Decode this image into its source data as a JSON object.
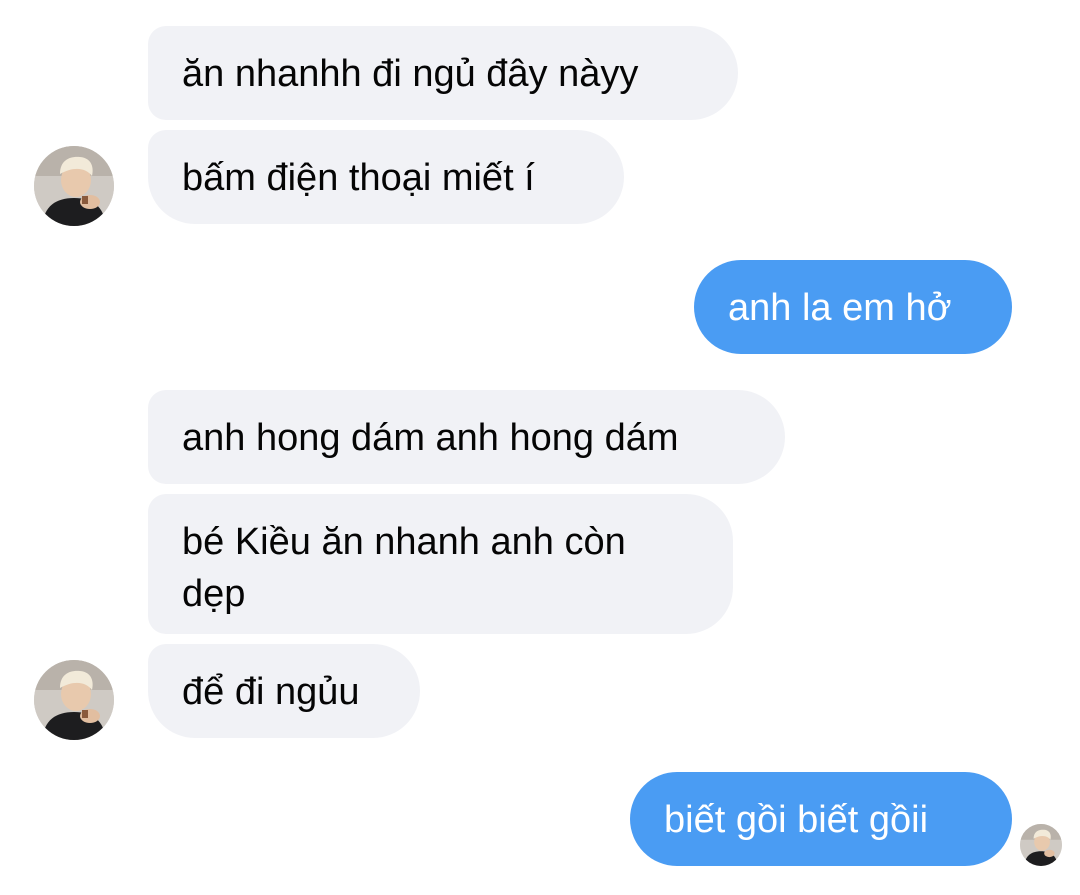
{
  "conversation": {
    "messages": [
      {
        "sender": "contact",
        "text": "ăn nhanhh đi ngủ đây nàyy"
      },
      {
        "sender": "contact",
        "text": "bấm điện thoại miết í"
      },
      {
        "sender": "me",
        "text": "anh la em hở"
      },
      {
        "sender": "contact",
        "text": "anh hong dám anh hong dám"
      },
      {
        "sender": "contact",
        "text": "bé Kiều ăn nhanh anh còn dẹp"
      },
      {
        "sender": "contact",
        "text": "để đi ngủu"
      },
      {
        "sender": "me",
        "text": "biết gồi biết gồii"
      }
    ]
  },
  "colors": {
    "incoming_bubble": "#f1f2f6",
    "outgoing_bubble": "#4a9cf3",
    "incoming_text": "#050505",
    "outgoing_text": "#ffffff"
  },
  "icons": {
    "contact_avatar": "contact-avatar-photo",
    "read_receipt": "read-receipt-avatar-photo"
  }
}
